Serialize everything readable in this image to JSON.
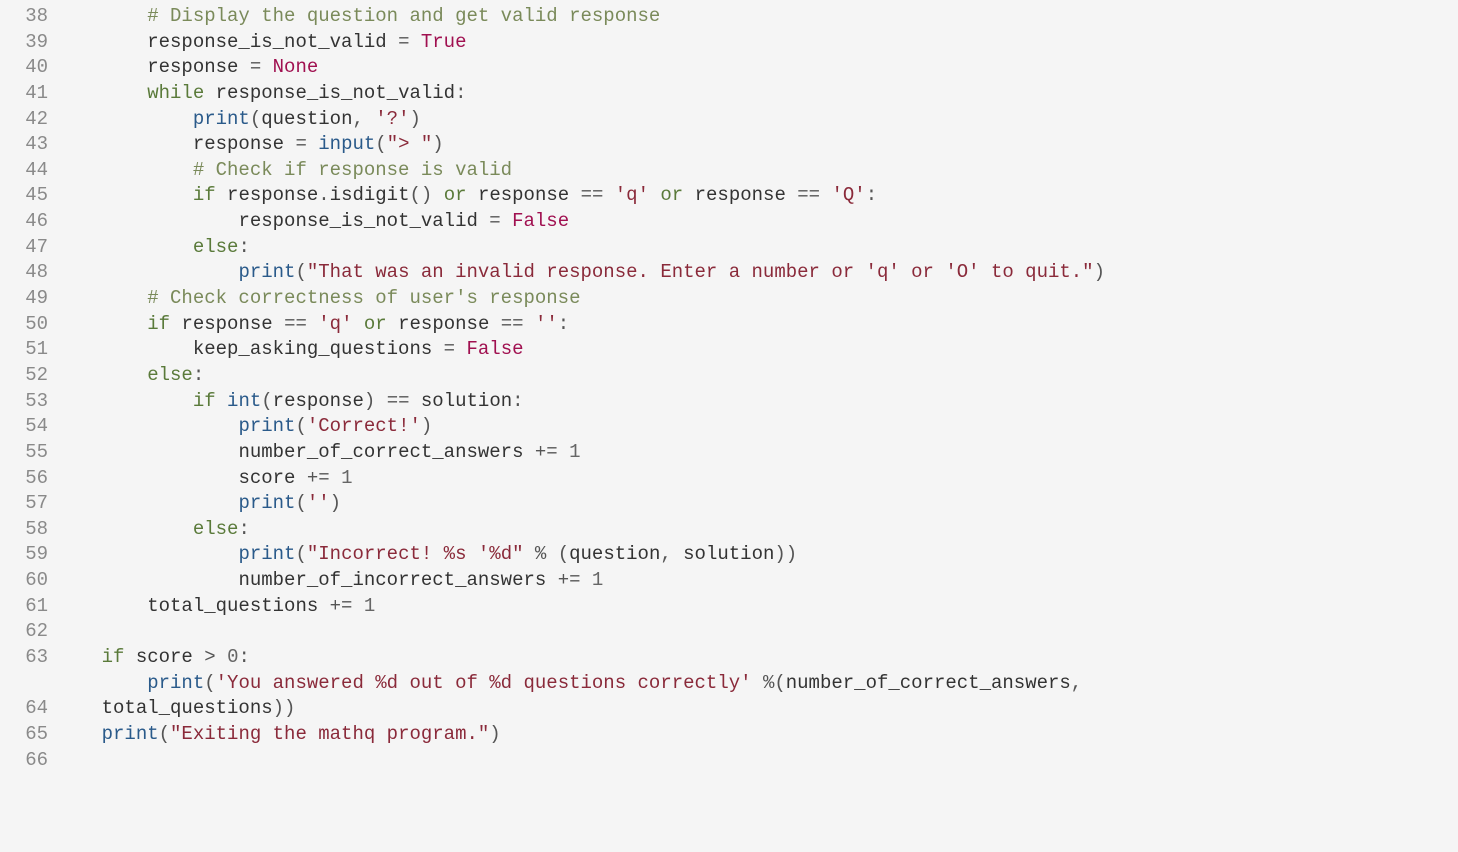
{
  "lines": [
    {
      "n": "38",
      "tokens": [
        {
          "cls": "",
          "t": "        "
        },
        {
          "cls": "c-comment",
          "t": "# Display the question and get valid response"
        }
      ]
    },
    {
      "n": "39",
      "tokens": [
        {
          "cls": "",
          "t": "        "
        },
        {
          "cls": "c-name",
          "t": "response_is_not_valid "
        },
        {
          "cls": "c-op",
          "t": "= "
        },
        {
          "cls": "c-bool",
          "t": "True"
        }
      ]
    },
    {
      "n": "40",
      "tokens": [
        {
          "cls": "",
          "t": "        "
        },
        {
          "cls": "c-name",
          "t": "response "
        },
        {
          "cls": "c-op",
          "t": "= "
        },
        {
          "cls": "c-bool",
          "t": "None"
        }
      ]
    },
    {
      "n": "41",
      "tokens": [
        {
          "cls": "",
          "t": "        "
        },
        {
          "cls": "c-keyword",
          "t": "while"
        },
        {
          "cls": "",
          "t": " "
        },
        {
          "cls": "c-name",
          "t": "response_is_not_valid"
        },
        {
          "cls": "c-op",
          "t": ":"
        }
      ]
    },
    {
      "n": "42",
      "tokens": [
        {
          "cls": "",
          "t": "            "
        },
        {
          "cls": "c-builtin",
          "t": "print"
        },
        {
          "cls": "c-op",
          "t": "("
        },
        {
          "cls": "c-name",
          "t": "question"
        },
        {
          "cls": "c-op",
          "t": ", "
        },
        {
          "cls": "c-string",
          "t": "'?'"
        },
        {
          "cls": "c-op",
          "t": ")"
        }
      ]
    },
    {
      "n": "43",
      "tokens": [
        {
          "cls": "",
          "t": "            "
        },
        {
          "cls": "c-name",
          "t": "response "
        },
        {
          "cls": "c-op",
          "t": "= "
        },
        {
          "cls": "c-builtin",
          "t": "input"
        },
        {
          "cls": "c-op",
          "t": "("
        },
        {
          "cls": "c-string",
          "t": "\"> \""
        },
        {
          "cls": "c-op",
          "t": ")"
        }
      ]
    },
    {
      "n": "44",
      "tokens": [
        {
          "cls": "",
          "t": "            "
        },
        {
          "cls": "c-comment",
          "t": "# Check if response is valid"
        }
      ]
    },
    {
      "n": "45",
      "tokens": [
        {
          "cls": "",
          "t": "            "
        },
        {
          "cls": "c-keyword",
          "t": "if"
        },
        {
          "cls": "",
          "t": " "
        },
        {
          "cls": "c-name",
          "t": "response"
        },
        {
          "cls": "c-op",
          "t": "."
        },
        {
          "cls": "c-name",
          "t": "isdigit"
        },
        {
          "cls": "c-op",
          "t": "() "
        },
        {
          "cls": "c-keyword",
          "t": "or"
        },
        {
          "cls": "",
          "t": " "
        },
        {
          "cls": "c-name",
          "t": "response "
        },
        {
          "cls": "c-op",
          "t": "== "
        },
        {
          "cls": "c-string",
          "t": "'q'"
        },
        {
          "cls": "",
          "t": " "
        },
        {
          "cls": "c-keyword",
          "t": "or"
        },
        {
          "cls": "",
          "t": " "
        },
        {
          "cls": "c-name",
          "t": "response "
        },
        {
          "cls": "c-op",
          "t": "== "
        },
        {
          "cls": "c-string",
          "t": "'Q'"
        },
        {
          "cls": "c-op",
          "t": ":"
        }
      ]
    },
    {
      "n": "46",
      "tokens": [
        {
          "cls": "",
          "t": "                "
        },
        {
          "cls": "c-name",
          "t": "response_is_not_valid "
        },
        {
          "cls": "c-op",
          "t": "= "
        },
        {
          "cls": "c-bool",
          "t": "False"
        }
      ]
    },
    {
      "n": "47",
      "tokens": [
        {
          "cls": "",
          "t": "            "
        },
        {
          "cls": "c-keyword",
          "t": "else"
        },
        {
          "cls": "c-op",
          "t": ":"
        }
      ]
    },
    {
      "n": "48",
      "tokens": [
        {
          "cls": "",
          "t": "                "
        },
        {
          "cls": "c-builtin",
          "t": "print"
        },
        {
          "cls": "c-op",
          "t": "("
        },
        {
          "cls": "c-string",
          "t": "\"That was an invalid response. Enter a number or 'q' or 'O' to quit.\""
        },
        {
          "cls": "c-op",
          "t": ")"
        }
      ]
    },
    {
      "n": "49",
      "tokens": [
        {
          "cls": "",
          "t": "        "
        },
        {
          "cls": "c-comment",
          "t": "# Check correctness of user's response"
        }
      ]
    },
    {
      "n": "50",
      "tokens": [
        {
          "cls": "",
          "t": "        "
        },
        {
          "cls": "c-keyword",
          "t": "if"
        },
        {
          "cls": "",
          "t": " "
        },
        {
          "cls": "c-name",
          "t": "response "
        },
        {
          "cls": "c-op",
          "t": "== "
        },
        {
          "cls": "c-string",
          "t": "'q'"
        },
        {
          "cls": "",
          "t": " "
        },
        {
          "cls": "c-keyword",
          "t": "or"
        },
        {
          "cls": "",
          "t": " "
        },
        {
          "cls": "c-name",
          "t": "response "
        },
        {
          "cls": "c-op",
          "t": "== "
        },
        {
          "cls": "c-string",
          "t": "''"
        },
        {
          "cls": "c-op",
          "t": ":"
        }
      ]
    },
    {
      "n": "51",
      "tokens": [
        {
          "cls": "",
          "t": "            "
        },
        {
          "cls": "c-name",
          "t": "keep_asking_questions "
        },
        {
          "cls": "c-op",
          "t": "= "
        },
        {
          "cls": "c-bool",
          "t": "False"
        }
      ]
    },
    {
      "n": "52",
      "tokens": [
        {
          "cls": "",
          "t": "        "
        },
        {
          "cls": "c-keyword",
          "t": "else"
        },
        {
          "cls": "c-op",
          "t": ":"
        }
      ]
    },
    {
      "n": "53",
      "tokens": [
        {
          "cls": "",
          "t": "            "
        },
        {
          "cls": "c-keyword",
          "t": "if"
        },
        {
          "cls": "",
          "t": " "
        },
        {
          "cls": "c-builtin",
          "t": "int"
        },
        {
          "cls": "c-op",
          "t": "("
        },
        {
          "cls": "c-name",
          "t": "response"
        },
        {
          "cls": "c-op",
          "t": ") == "
        },
        {
          "cls": "c-name",
          "t": "solution"
        },
        {
          "cls": "c-op",
          "t": ":"
        }
      ]
    },
    {
      "n": "54",
      "tokens": [
        {
          "cls": "",
          "t": "                "
        },
        {
          "cls": "c-builtin",
          "t": "print"
        },
        {
          "cls": "c-op",
          "t": "("
        },
        {
          "cls": "c-string",
          "t": "'Correct!'"
        },
        {
          "cls": "c-op",
          "t": ")"
        }
      ]
    },
    {
      "n": "55",
      "tokens": [
        {
          "cls": "",
          "t": "                "
        },
        {
          "cls": "c-name",
          "t": "number_of_correct_answers "
        },
        {
          "cls": "c-op",
          "t": "+= "
        },
        {
          "cls": "c-number",
          "t": "1"
        }
      ]
    },
    {
      "n": "56",
      "tokens": [
        {
          "cls": "",
          "t": "                "
        },
        {
          "cls": "c-name",
          "t": "score "
        },
        {
          "cls": "c-op",
          "t": "+= "
        },
        {
          "cls": "c-number",
          "t": "1"
        }
      ]
    },
    {
      "n": "57",
      "tokens": [
        {
          "cls": "",
          "t": "                "
        },
        {
          "cls": "c-builtin",
          "t": "print"
        },
        {
          "cls": "c-op",
          "t": "("
        },
        {
          "cls": "c-string",
          "t": "''"
        },
        {
          "cls": "c-op",
          "t": ")"
        }
      ]
    },
    {
      "n": "58",
      "tokens": [
        {
          "cls": "",
          "t": "            "
        },
        {
          "cls": "c-keyword",
          "t": "else"
        },
        {
          "cls": "c-op",
          "t": ":"
        }
      ]
    },
    {
      "n": "59",
      "tokens": [
        {
          "cls": "",
          "t": "                "
        },
        {
          "cls": "c-builtin",
          "t": "print"
        },
        {
          "cls": "c-op",
          "t": "("
        },
        {
          "cls": "c-string",
          "t": "\"Incorrect! %s '%d\""
        },
        {
          "cls": "",
          "t": " "
        },
        {
          "cls": "c-op",
          "t": "% ("
        },
        {
          "cls": "c-name",
          "t": "question"
        },
        {
          "cls": "c-op",
          "t": ", "
        },
        {
          "cls": "c-name",
          "t": "solution"
        },
        {
          "cls": "c-op",
          "t": "))"
        }
      ]
    },
    {
      "n": "60",
      "tokens": [
        {
          "cls": "",
          "t": "                "
        },
        {
          "cls": "c-name",
          "t": "number_of_incorrect_answers "
        },
        {
          "cls": "c-op",
          "t": "+= "
        },
        {
          "cls": "c-number",
          "t": "1"
        }
      ]
    },
    {
      "n": "61",
      "tokens": [
        {
          "cls": "",
          "t": "        "
        },
        {
          "cls": "c-name",
          "t": "total_questions "
        },
        {
          "cls": "c-op",
          "t": "+= "
        },
        {
          "cls": "c-number",
          "t": "1"
        }
      ]
    },
    {
      "n": "62",
      "tokens": [
        {
          "cls": "",
          "t": ""
        }
      ]
    },
    {
      "n": "63",
      "tokens": [
        {
          "cls": "",
          "t": "    "
        },
        {
          "cls": "c-keyword",
          "t": "if"
        },
        {
          "cls": "",
          "t": " "
        },
        {
          "cls": "c-name",
          "t": "score "
        },
        {
          "cls": "c-op",
          "t": "> "
        },
        {
          "cls": "c-number",
          "t": "0"
        },
        {
          "cls": "c-op",
          "t": ":"
        }
      ]
    },
    {
      "n": "",
      "tokens": [
        {
          "cls": "",
          "t": "        "
        },
        {
          "cls": "c-builtin",
          "t": "print"
        },
        {
          "cls": "c-op",
          "t": "("
        },
        {
          "cls": "c-string",
          "t": "'You answered %d out of %d questions correctly'"
        },
        {
          "cls": "",
          "t": " "
        },
        {
          "cls": "c-op",
          "t": "%("
        },
        {
          "cls": "c-name",
          "t": "number_of_correct_answers"
        },
        {
          "cls": "c-op",
          "t": ", "
        }
      ]
    },
    {
      "n": "64",
      "tokens": [
        {
          "cls": "",
          "t": "    "
        },
        {
          "cls": "c-name",
          "t": "total_questions"
        },
        {
          "cls": "c-op",
          "t": "))"
        }
      ]
    },
    {
      "n": "65",
      "tokens": [
        {
          "cls": "",
          "t": "    "
        },
        {
          "cls": "c-builtin",
          "t": "print"
        },
        {
          "cls": "c-op",
          "t": "("
        },
        {
          "cls": "c-string",
          "t": "\"Exiting the mathq program.\""
        },
        {
          "cls": "c-op",
          "t": ")"
        }
      ]
    },
    {
      "n": "66",
      "tokens": [
        {
          "cls": "",
          "t": ""
        }
      ]
    }
  ]
}
